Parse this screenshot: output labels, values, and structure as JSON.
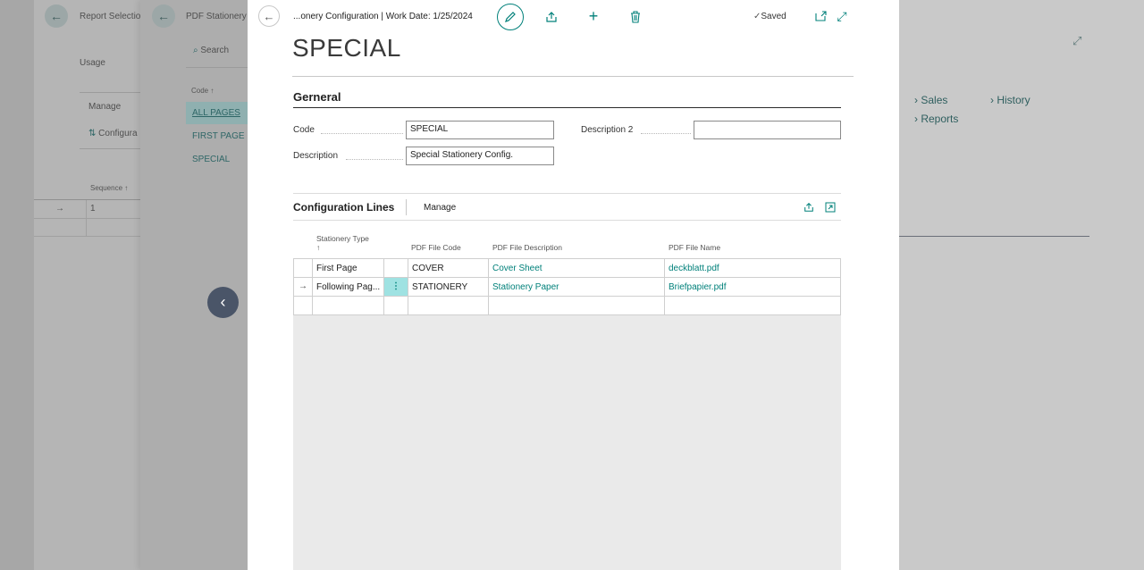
{
  "back_panels": {
    "report_selection": {
      "title": "Report Selectio",
      "usage_label": "Usage",
      "manage_label": "Manage",
      "configure_label": "Configura",
      "sequence_header": "Sequence ↑",
      "sequence_value": "1"
    },
    "pdf_stationery": {
      "title": "PDF Stationery",
      "search_label": "Search",
      "code_header": "Code ↑",
      "codes": [
        "ALL PAGES",
        "FIRST PAGE",
        "SPECIAL"
      ]
    }
  },
  "right_bg": {
    "links": [
      "Sales",
      "History",
      "Reports"
    ]
  },
  "dialog": {
    "breadcrumb": "...onery Configuration | Work Date: 1/25/2024",
    "saved_label": "Saved",
    "title": "SPECIAL",
    "section_title": "Gerneral",
    "fields": {
      "code_label": "Code",
      "code_value": "SPECIAL",
      "description_label": "Description",
      "description_value": "Special Stationery Config.",
      "description2_label": "Description 2",
      "description2_value": ""
    },
    "lines": {
      "title": "Configuration Lines",
      "manage_label": "Manage",
      "headers": {
        "stationery_type": "Stationery Type",
        "sort_arrow": "↑",
        "pdf_file_code": "PDF File Code",
        "pdf_file_description": "PDF File Description",
        "pdf_file_name": "PDF File Name"
      },
      "rows": [
        {
          "type": "First Page",
          "code": "COVER",
          "description": "Cover Sheet",
          "file": "deckblatt.pdf"
        },
        {
          "type": "Following Pag...",
          "code": "STATIONERY",
          "description": "Stationery Paper",
          "file": "Briefpapier.pdf"
        }
      ]
    }
  }
}
